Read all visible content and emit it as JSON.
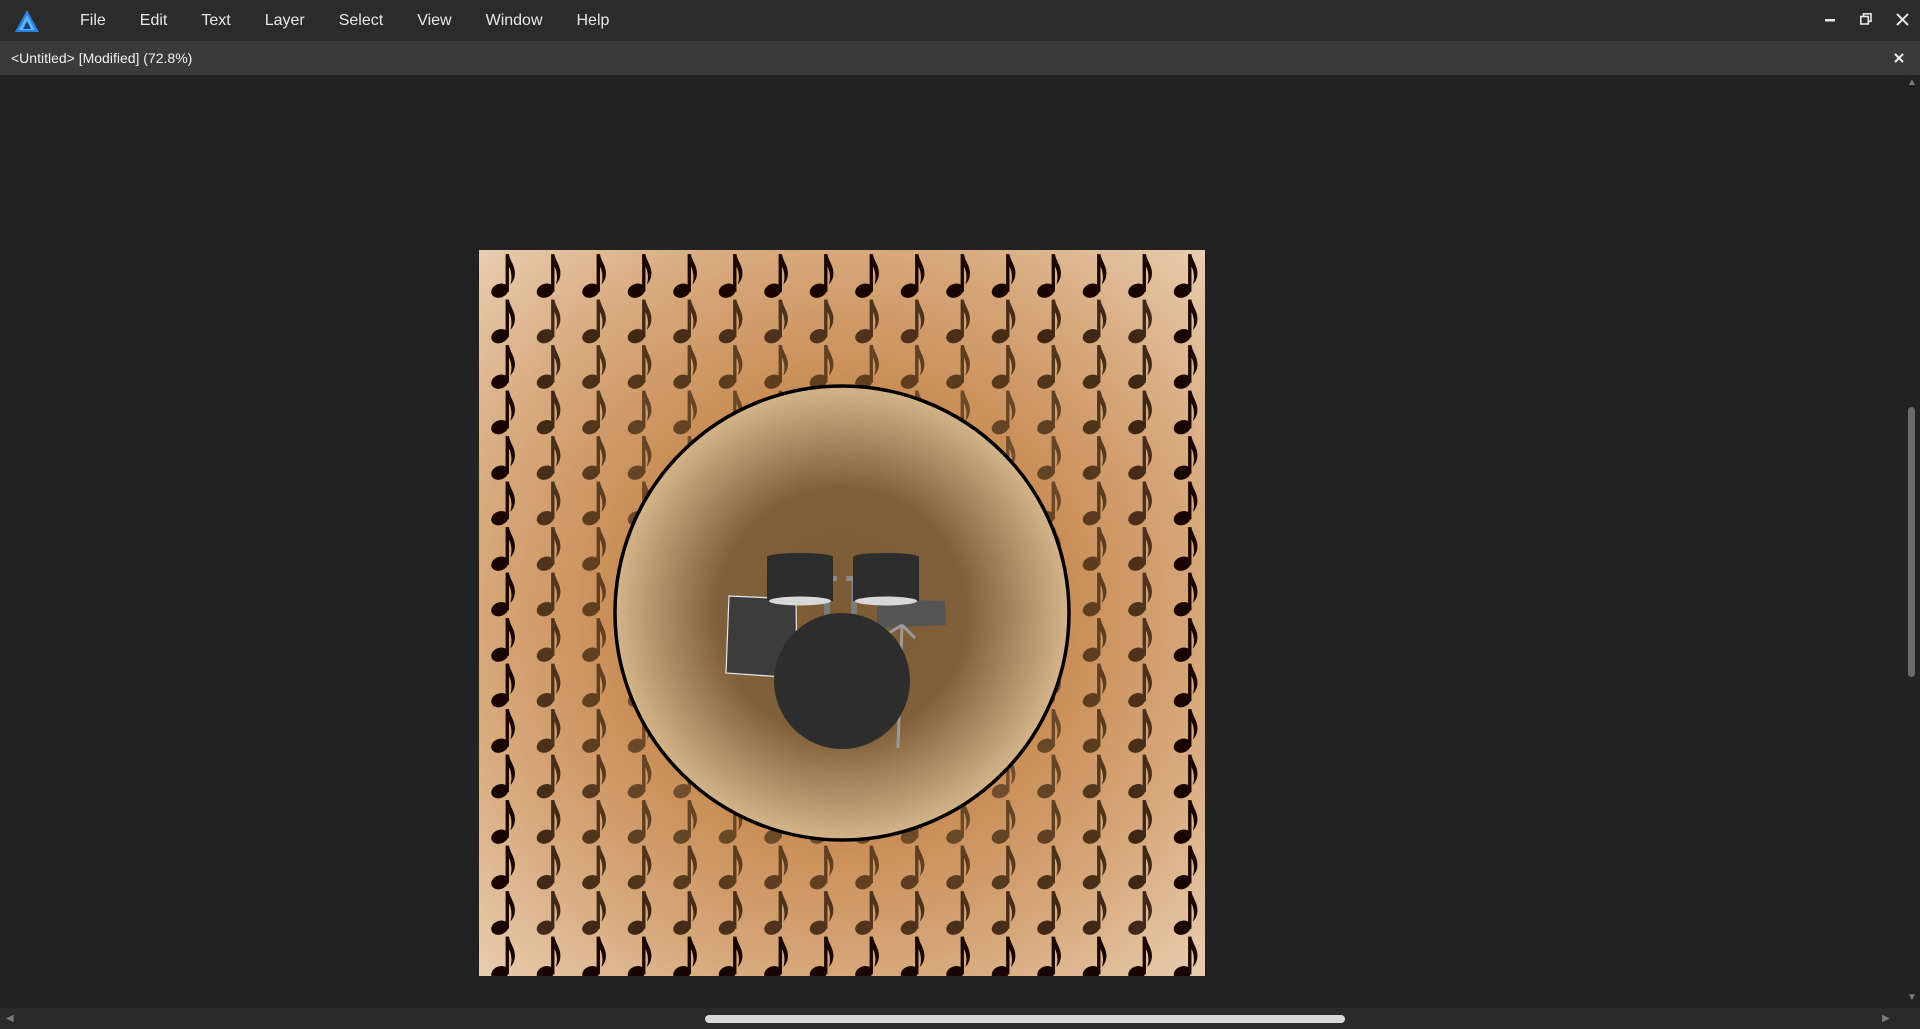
{
  "app": {
    "menu": [
      "File",
      "Edit",
      "Text",
      "Layer",
      "Select",
      "View",
      "Window",
      "Help"
    ],
    "window_controls": [
      "minimize-icon",
      "restore-icon",
      "close-icon"
    ]
  },
  "document_tab": {
    "title": "<Untitled> [Modified] (72.8%)",
    "close_icon": "close-icon"
  },
  "artwork": {
    "description_icons": [
      "music-note-icon",
      "drum-kit-icon"
    ],
    "colors": {
      "background_center": "#c9844a",
      "background_edge": "#e8cdb0",
      "circle_center": "#7c5a34",
      "circle_edge": "#d4b48a",
      "circle_border": "#000000",
      "drum_dark": "#2d2d2d",
      "drum_mid": "#3c3c3c",
      "drum_head": "#d8d8d8",
      "hardware": "#9a9a9a"
    }
  },
  "colors": {
    "menubar": "#2b2b2b",
    "tabbar": "#3a3a3a",
    "canvas": "#222222",
    "accent": "#2f7fe0"
  }
}
